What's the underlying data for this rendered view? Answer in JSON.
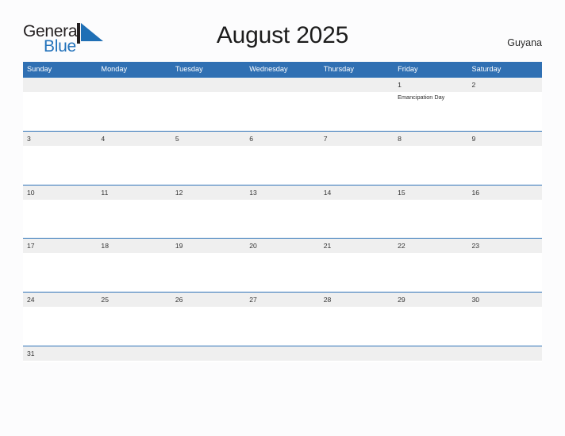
{
  "logo": {
    "word_one": "General",
    "word_two": "Blue",
    "mark": "triangle-flag",
    "color_dark": "#231f20",
    "color_blue": "#2272bb"
  },
  "header": {
    "title": "August 2025",
    "country": "Guyana"
  },
  "theme": {
    "header_blue": "#3070b3",
    "rule_blue": "#2e73b8",
    "band_gray": "#efefef",
    "page_background": "#fcfcfd"
  },
  "calendar": {
    "weekdays": [
      "Sunday",
      "Monday",
      "Tuesday",
      "Wednesday",
      "Thursday",
      "Friday",
      "Saturday"
    ],
    "weeks": [
      {
        "days": [
          {
            "date": "",
            "event": ""
          },
          {
            "date": "",
            "event": ""
          },
          {
            "date": "",
            "event": ""
          },
          {
            "date": "",
            "event": ""
          },
          {
            "date": "",
            "event": ""
          },
          {
            "date": "1",
            "event": "Emancipation Day"
          },
          {
            "date": "2",
            "event": ""
          }
        ]
      },
      {
        "days": [
          {
            "date": "3",
            "event": ""
          },
          {
            "date": "4",
            "event": ""
          },
          {
            "date": "5",
            "event": ""
          },
          {
            "date": "6",
            "event": ""
          },
          {
            "date": "7",
            "event": ""
          },
          {
            "date": "8",
            "event": ""
          },
          {
            "date": "9",
            "event": ""
          }
        ]
      },
      {
        "days": [
          {
            "date": "10",
            "event": ""
          },
          {
            "date": "11",
            "event": ""
          },
          {
            "date": "12",
            "event": ""
          },
          {
            "date": "13",
            "event": ""
          },
          {
            "date": "14",
            "event": ""
          },
          {
            "date": "15",
            "event": ""
          },
          {
            "date": "16",
            "event": ""
          }
        ]
      },
      {
        "days": [
          {
            "date": "17",
            "event": ""
          },
          {
            "date": "18",
            "event": ""
          },
          {
            "date": "19",
            "event": ""
          },
          {
            "date": "20",
            "event": ""
          },
          {
            "date": "21",
            "event": ""
          },
          {
            "date": "22",
            "event": ""
          },
          {
            "date": "23",
            "event": ""
          }
        ]
      },
      {
        "days": [
          {
            "date": "24",
            "event": ""
          },
          {
            "date": "25",
            "event": ""
          },
          {
            "date": "26",
            "event": ""
          },
          {
            "date": "27",
            "event": ""
          },
          {
            "date": "28",
            "event": ""
          },
          {
            "date": "29",
            "event": ""
          },
          {
            "date": "30",
            "event": ""
          }
        ]
      },
      {
        "days": [
          {
            "date": "31",
            "event": ""
          },
          {
            "date": "",
            "event": ""
          },
          {
            "date": "",
            "event": ""
          },
          {
            "date": "",
            "event": ""
          },
          {
            "date": "",
            "event": ""
          },
          {
            "date": "",
            "event": ""
          },
          {
            "date": "",
            "event": ""
          }
        ]
      }
    ]
  }
}
